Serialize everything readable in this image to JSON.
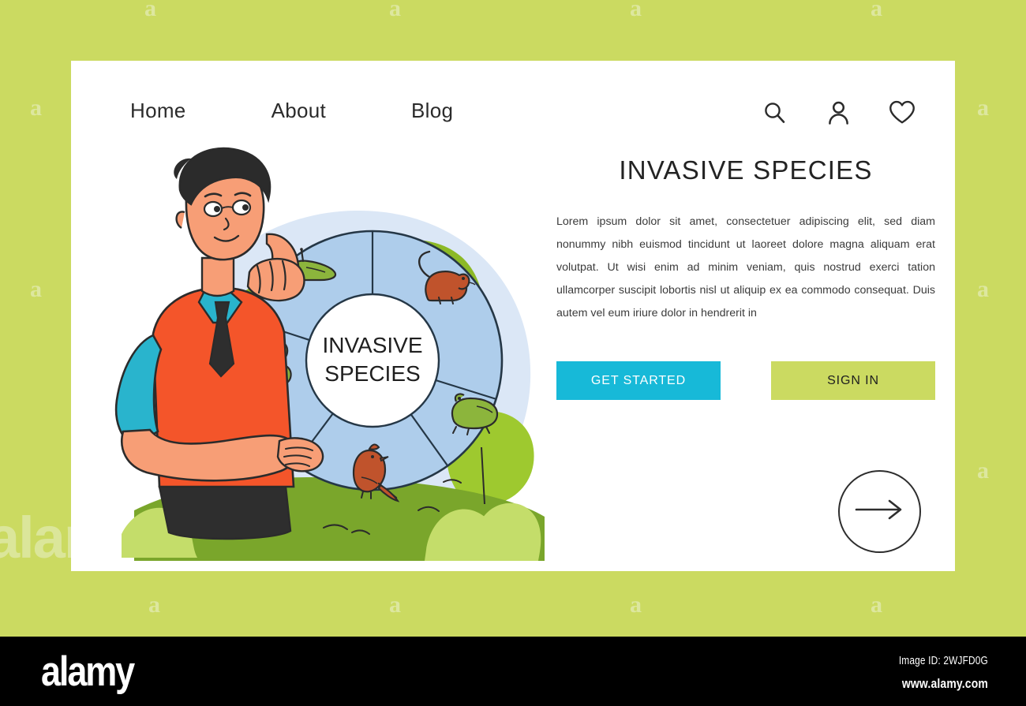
{
  "page": {
    "background_color": "#cbda61",
    "card_background": "#ffffff"
  },
  "nav": {
    "links": [
      {
        "label": "Home",
        "name": "nav-link-home"
      },
      {
        "label": "About",
        "name": "nav-link-about"
      },
      {
        "label": "Blog",
        "name": "nav-link-blog"
      }
    ],
    "icons": [
      {
        "name": "search-icon",
        "label": "search"
      },
      {
        "name": "user-icon",
        "label": "account"
      },
      {
        "name": "heart-icon",
        "label": "favorites"
      }
    ]
  },
  "hero": {
    "title": "INVASIVE SPECIES",
    "paragraph": "Lorem ipsum dolor sit amet, consectetuer adipiscing elit, sed diam nonummy nibh euismod tincidunt ut laoreet dolore magna aliquam erat volutpat. Ut wisi enim ad minim veniam, quis nostrud exerci tation ullamcorper suscipit lobortis nisl ut aliquip ex ea commodo consequat. Duis autem vel eum iriure dolor in hendrerit in",
    "primary_button": "GET STARTED",
    "secondary_button": "SIGN IN",
    "primary_button_color": "#17b9d8",
    "secondary_button_color": "#cbda61",
    "arrow_button_name": "next-arrow-button"
  },
  "illustration": {
    "wheel_center_line1": "INVASIVE",
    "wheel_center_line2": "SPECIES",
    "wheel_color": "#aecdeb",
    "segments": [
      {
        "name": "segment-slug",
        "icon": "slug-icon"
      },
      {
        "name": "segment-rodent",
        "icon": "rodent-icon"
      },
      {
        "name": "segment-frog",
        "icon": "frog-icon"
      },
      {
        "name": "segment-bird",
        "icon": "bird-icon"
      },
      {
        "name": "segment-plant",
        "icon": "clover-plant-icon"
      }
    ],
    "character": {
      "name": "person-illustration",
      "vest_color": "#f4552a",
      "shirt_color": "#29b4cd",
      "hair_color": "#2b2b2b",
      "skin_color": "#f79e76"
    },
    "foliage_colors": [
      "#8cb926",
      "#7aa62b",
      "#c4dd6a"
    ]
  },
  "watermark": {
    "glyph": "a",
    "brand": "alamy",
    "top_row": [
      190,
      500,
      805,
      1110
    ],
    "left_col": [
      235,
      465,
      600
    ],
    "right_col": [
      235,
      465,
      695
    ],
    "bottom_row": [
      195,
      500,
      805,
      1110
    ]
  },
  "footer": {
    "logo": "alamy",
    "image_id": "Image ID: 2WJFD0G",
    "url": "www.alamy.com",
    "background_color": "#000000"
  }
}
